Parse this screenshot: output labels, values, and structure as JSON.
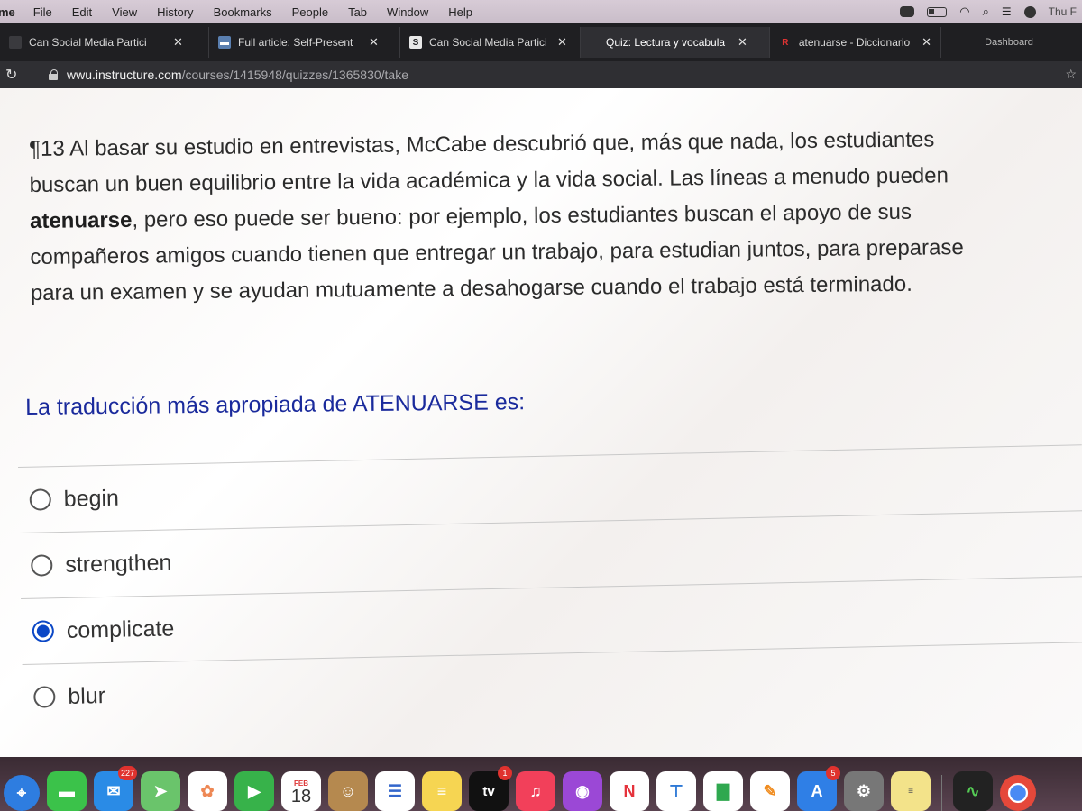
{
  "menubar": {
    "app": "me",
    "items": [
      "File",
      "Edit",
      "View",
      "History",
      "Bookmarks",
      "People",
      "Tab",
      "Window",
      "Help"
    ],
    "clock": "Thu F"
  },
  "tabs": [
    {
      "title": "Can Social Media Partici",
      "active": false
    },
    {
      "title": "Full article: Self-Present",
      "active": false
    },
    {
      "title": "Can Social Media Partici",
      "active": false
    },
    {
      "title": "Quiz: Lectura y vocabula",
      "active": true
    },
    {
      "title": "atenuarse - Diccionario",
      "active": false
    },
    {
      "title": "Dashboard",
      "active": false
    }
  ],
  "address": {
    "host": "wwu.instructure.com",
    "path": "/courses/1415948/quizzes/1365830/take"
  },
  "passage": {
    "line1": "¶13 Al basar su estudio en entrevistas, McCabe descubrió que, más que nada, los estudiantes",
    "line2": "buscan un buen equilibrio entre la vida académica y la vida social. Las líneas a menudo pueden",
    "bold_word": "atenuarse",
    "line3_rest": ", pero eso puede ser bueno: por ejemplo, los estudiantes buscan el apoyo de sus",
    "line4": "compañeros amigos cuando tienen que entregar un trabajo, para estudian juntos, para preparase",
    "line5": "para un examen y se ayudan mutuamente a desahogarse cuando el trabajo está terminado."
  },
  "question": "La traducción más apropiada de ATENUARSE es:",
  "answers": [
    {
      "label": "begin",
      "selected": false
    },
    {
      "label": "strengthen",
      "selected": false
    },
    {
      "label": "complicate",
      "selected": true
    },
    {
      "label": "blur",
      "selected": false
    }
  ],
  "dock": {
    "mail_badge": "227",
    "calendar_month": "FEB",
    "calendar_day": "18",
    "tv_label": "tv",
    "tv_badge": "1",
    "appstore_badge": "5"
  },
  "colors": {
    "question": "#1a2a9c",
    "radio_selected": "#0b47c6"
  }
}
